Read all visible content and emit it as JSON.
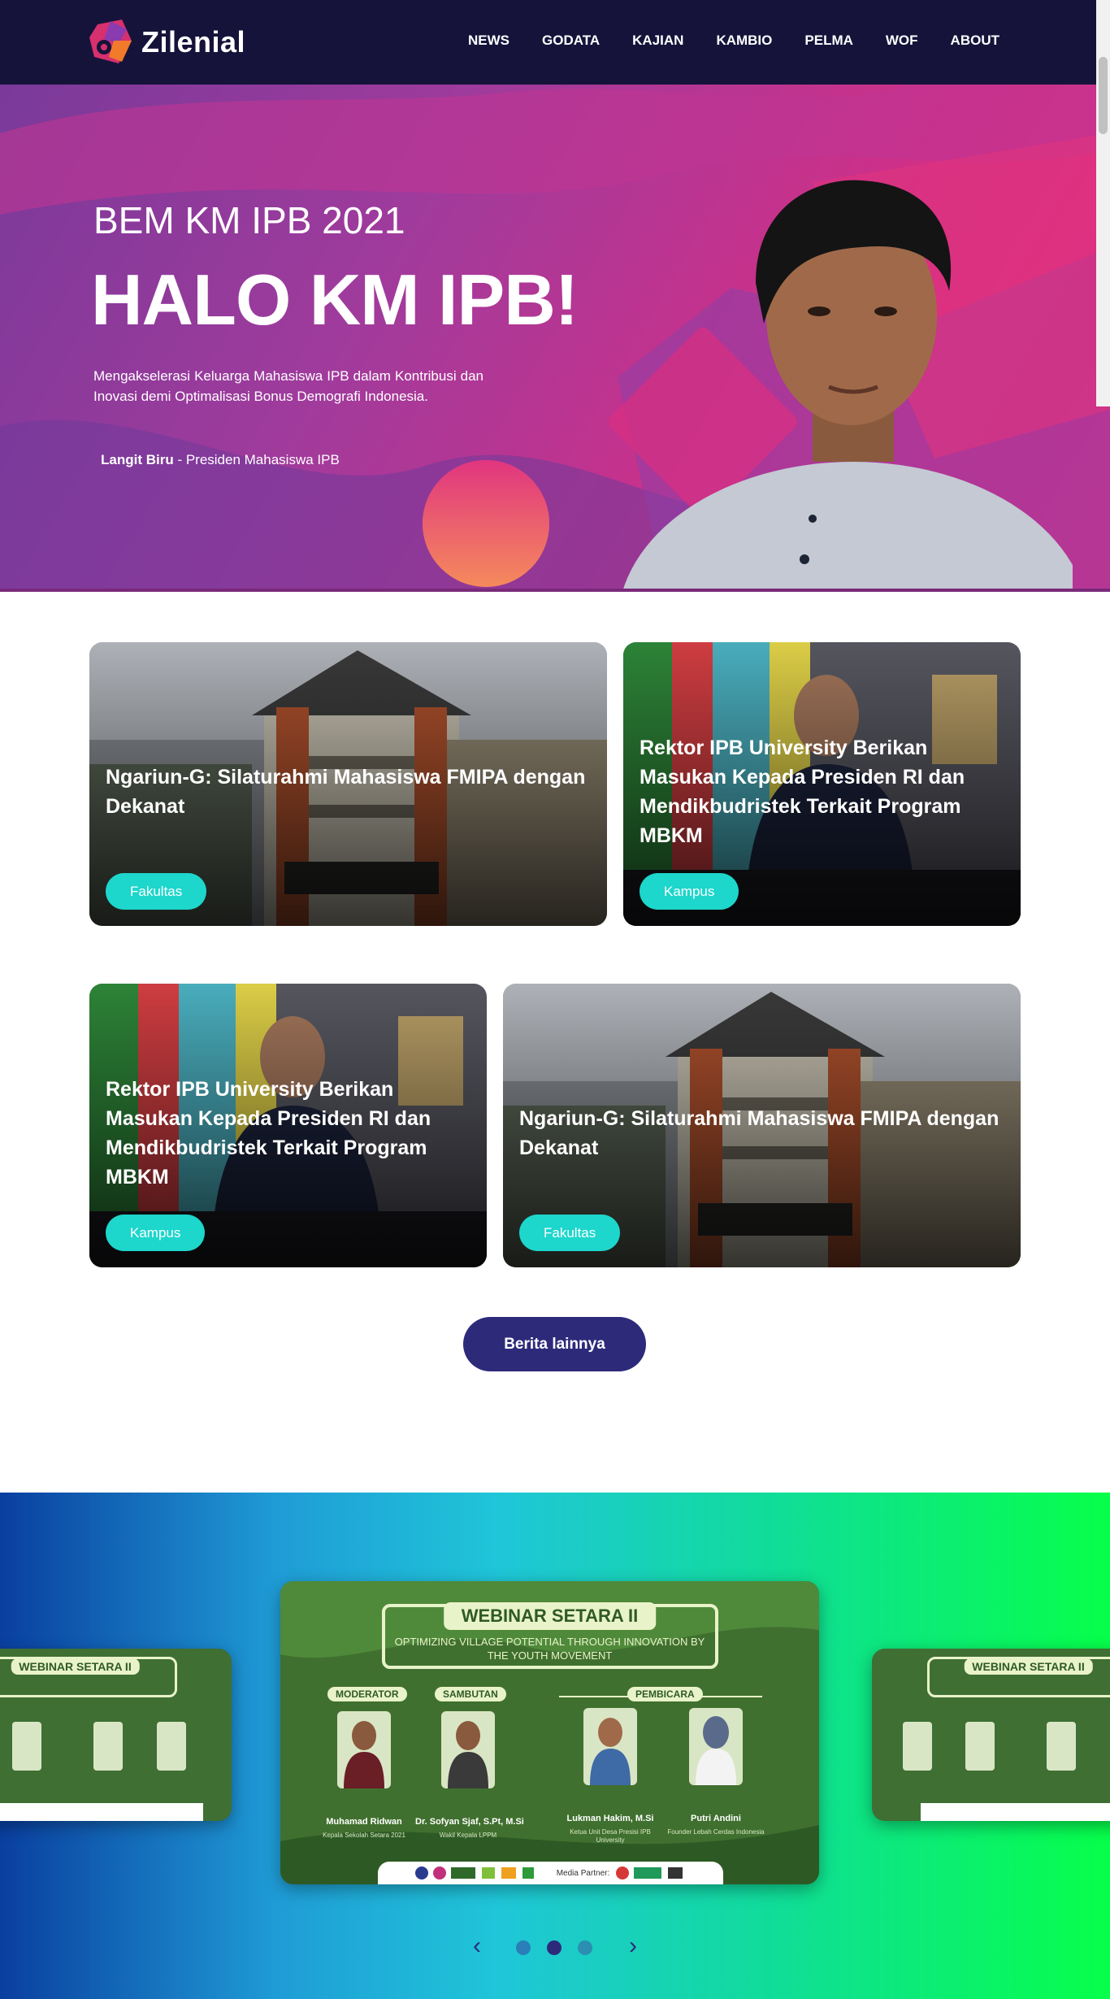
{
  "brand": {
    "name": "Zilenial"
  },
  "nav": {
    "items": [
      {
        "label": "NEWS"
      },
      {
        "label": "GODATA"
      },
      {
        "label": "KAJIAN"
      },
      {
        "label": "KAMBIO"
      },
      {
        "label": "PELMA"
      },
      {
        "label": "WOF"
      },
      {
        "label": "ABOUT"
      }
    ]
  },
  "hero": {
    "subtitle": "BEM KM IPB 2021",
    "title": "HALO KM IPB!",
    "description": "Mengakselerasi Keluarga Mahasiswa IPB dalam Kontribusi dan Inovasi demi Optimalisasi Bonus Demografi Indonesia.",
    "credit_name": "Langit Biru",
    "credit_role": " - Presiden Mahasiswa IPB"
  },
  "news": {
    "cards": [
      {
        "title": "Ngariun-G: Silaturahmi Mahasiswa FMIPA dengan Dekanat",
        "tag": "Fakultas"
      },
      {
        "title": "Rektor IPB University Berikan Masukan Kepada Presiden RI dan Mendikbudristek Terkait Program MBKM",
        "tag": "Kampus"
      },
      {
        "title": "Rektor IPB University Berikan Masukan Kepada Presiden RI dan Mendikbudristek Terkait Program MBKM",
        "tag": "Kampus"
      },
      {
        "title": "Ngariun-G: Silaturahmi Mahasiswa FMIPA dengan Dekanat",
        "tag": "Fakultas"
      }
    ],
    "more_label": "Berita lainnya"
  },
  "carousel": {
    "poster": {
      "title": "WEBINAR SETARA II",
      "subtitle": "OPTIMIZING VILLAGE POTENTIAL THROUGH INNOVATION BY THE YOUTH MOVEMENT",
      "section_moderator": "MODERATOR",
      "section_sambutan": "SAMBUTAN",
      "section_pembicara": "PEMBICARA",
      "speakers": [
        {
          "name": "Muhamad Ridwan",
          "role": "Kepala Sekolah Setara 2021"
        },
        {
          "name": "Dr. Sofyan Sjaf, S.Pt, M.Si",
          "role": "Wakil Kepala LPPM"
        },
        {
          "name": "Lukman Hakim, M.Si",
          "role": "Ketua Unit Desa Presisi IPB University"
        },
        {
          "name": "Putri Andini",
          "role": "Founder Lebah Cerdas Indonesia"
        }
      ],
      "media_partner": "Media Partner:"
    },
    "prev_label": "‹",
    "next_label": "›",
    "dots": 3,
    "active_dot": 2
  },
  "colors": {
    "navbar": "#15133a",
    "accent_tag": "#1dd6cc",
    "button": "#2e2a7a"
  }
}
